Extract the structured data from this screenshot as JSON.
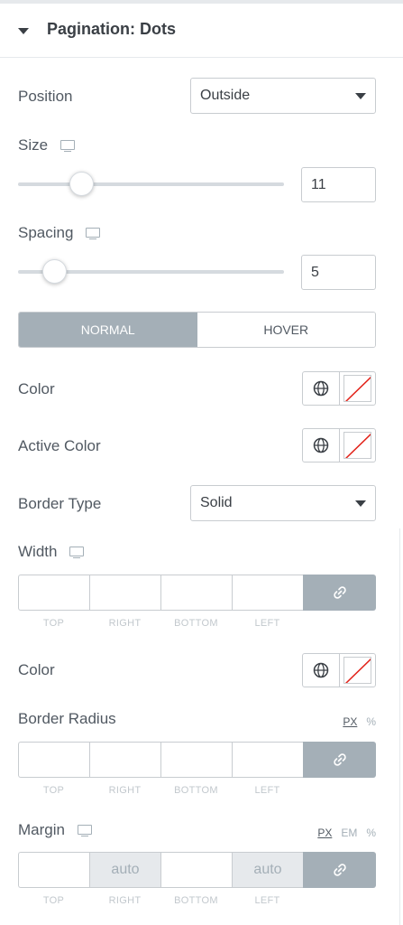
{
  "section": {
    "title": "Pagination: Dots"
  },
  "position": {
    "label": "Position",
    "value": "Outside"
  },
  "size": {
    "label": "Size",
    "value": "11",
    "slider_level": 0.24
  },
  "spacing": {
    "label": "Spacing",
    "value": "5",
    "slider_level": 0.14
  },
  "tabs": {
    "normal": "NORMAL",
    "hover": "HOVER",
    "active": "NORMAL"
  },
  "color": {
    "label": "Color"
  },
  "active_color": {
    "label": "Active Color"
  },
  "border_type": {
    "label": "Border Type",
    "value": "Solid"
  },
  "width": {
    "label": "Width",
    "top": "",
    "right": "",
    "bottom": "",
    "left": ""
  },
  "border_color": {
    "label": "Color"
  },
  "border_radius": {
    "label": "Border Radius",
    "units": [
      "PX",
      "%"
    ],
    "active_unit": "PX",
    "top": "",
    "right": "",
    "bottom": "",
    "left": ""
  },
  "margin": {
    "label": "Margin",
    "units": [
      "PX",
      "EM",
      "%"
    ],
    "active_unit": "PX",
    "top": "",
    "right": "auto",
    "bottom": "",
    "left": "auto"
  },
  "dimension_labels": {
    "top": "TOP",
    "right": "RIGHT",
    "bottom": "BOTTOM",
    "left": "LEFT"
  },
  "icons": {
    "responsive": "monitor-icon",
    "global": "globe-icon",
    "link": "link-icon",
    "no_color": "no-color-swatch"
  },
  "colors": {
    "tab_active": "#a4afb7",
    "no_color_line": "#e2231a",
    "text": "#515962"
  }
}
